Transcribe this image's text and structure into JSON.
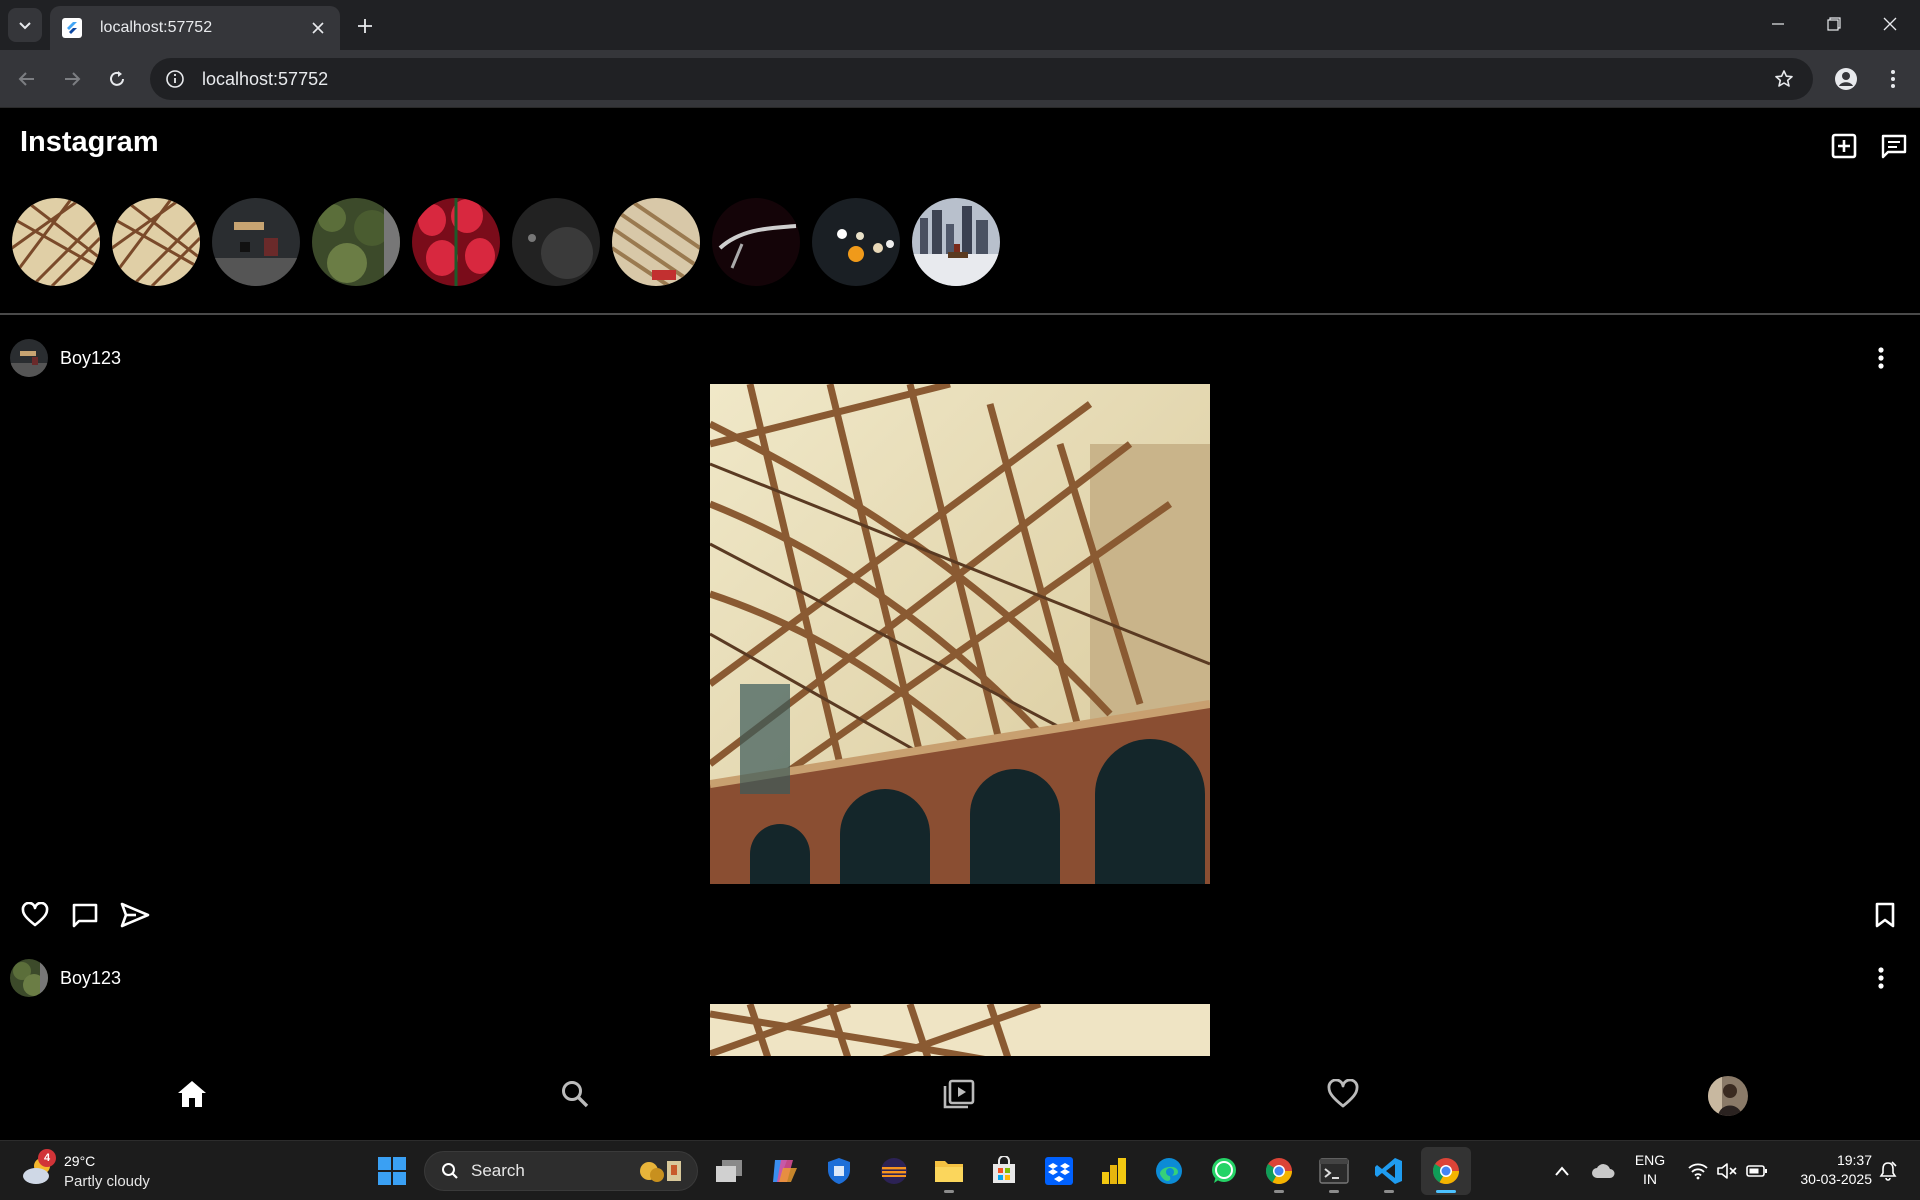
{
  "browser": {
    "tab_title": "localhost:57752",
    "url": "localhost:57752"
  },
  "app": {
    "title": "Instagram",
    "posts": [
      {
        "username": "Boy123"
      },
      {
        "username": "Boy123"
      }
    ]
  },
  "taskbar": {
    "weather_badge": "4",
    "weather_temp": "29°C",
    "weather_desc": "Partly cloudy",
    "search_label": "Search",
    "lang_line1": "ENG",
    "lang_line2": "IN",
    "time": "19:37",
    "date": "30-03-2025"
  },
  "colors": {
    "accent": "#4cc2ff",
    "app_bg": "#000000",
    "chrome_bg": "#202124",
    "toolbar_bg": "#35363a"
  }
}
